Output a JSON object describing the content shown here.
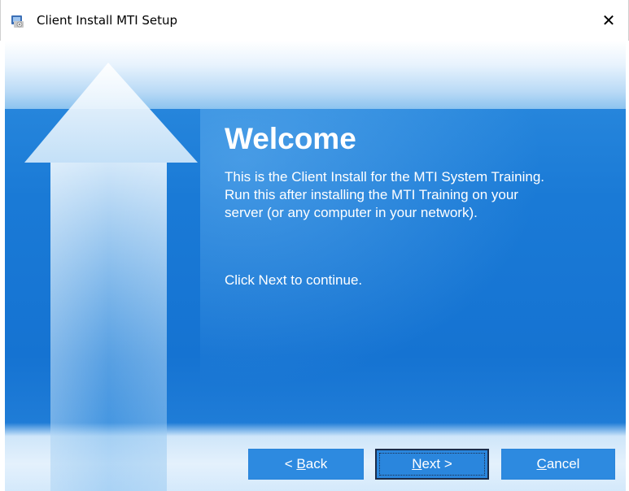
{
  "window": {
    "title": "Client Install MTI Setup",
    "close_symbol": "✕",
    "icon": "installer-icon"
  },
  "content": {
    "heading": "Welcome",
    "body": "This is the Client Install for the MTI System Training.\nRun this after installing the MTI Training on your\nserver (or any computer in your network).",
    "continue_text": "Click Next to continue."
  },
  "buttons": {
    "back": {
      "prefix": "< ",
      "access_key": "B",
      "rest": "ack"
    },
    "next": {
      "access_key": "N",
      "rest": "ext >"
    },
    "cancel": {
      "access_key": "C",
      "rest": "ancel"
    }
  },
  "colors": {
    "background_blue": "#1a7ad6",
    "button_blue": "#2d8ae0",
    "text": "#ffffff"
  },
  "icons": [
    "installer-icon",
    "close-icon",
    "up-arrow-graphic"
  ]
}
